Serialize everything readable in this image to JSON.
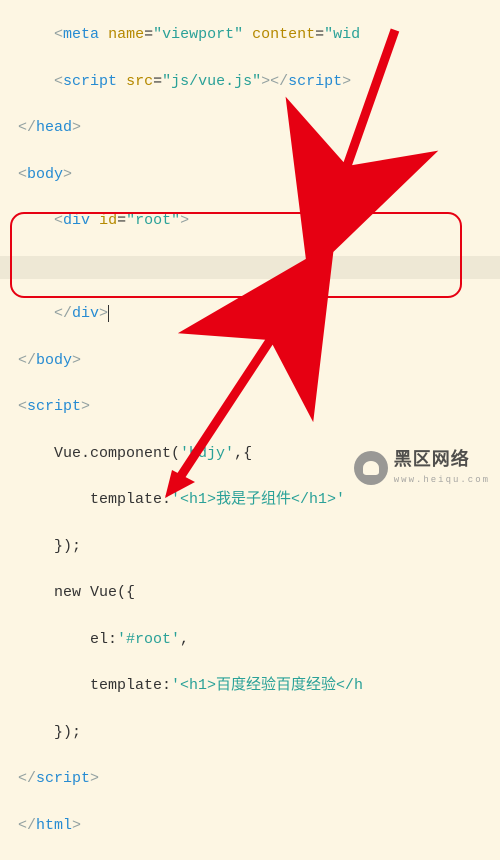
{
  "code": {
    "l1_meta_partial": "    <meta name=\"viewport\" content=\"wid",
    "l2": "    <script src=\"js/vue.js\"></script>",
    "l3": "</head>",
    "l4": "<body>",
    "l5": "    <div id=\"root\">",
    "l6": "",
    "l7": "    </div>",
    "l8": "</body>",
    "l9": "<script>",
    "l10": "    Vue.component('bdjy',{",
    "l11": "        template:'<h1>我是子组件</h1>'",
    "l12": "    });",
    "l13": "    new Vue({",
    "l14": "        el:'#root',",
    "l15": "        template:'<h1>百度经验百度经验</h1",
    "l16": "    });",
    "l17": "</script>",
    "l18": "</html>"
  },
  "watermark": {
    "text": "黑区网络",
    "url": "www.heiqu.com"
  }
}
